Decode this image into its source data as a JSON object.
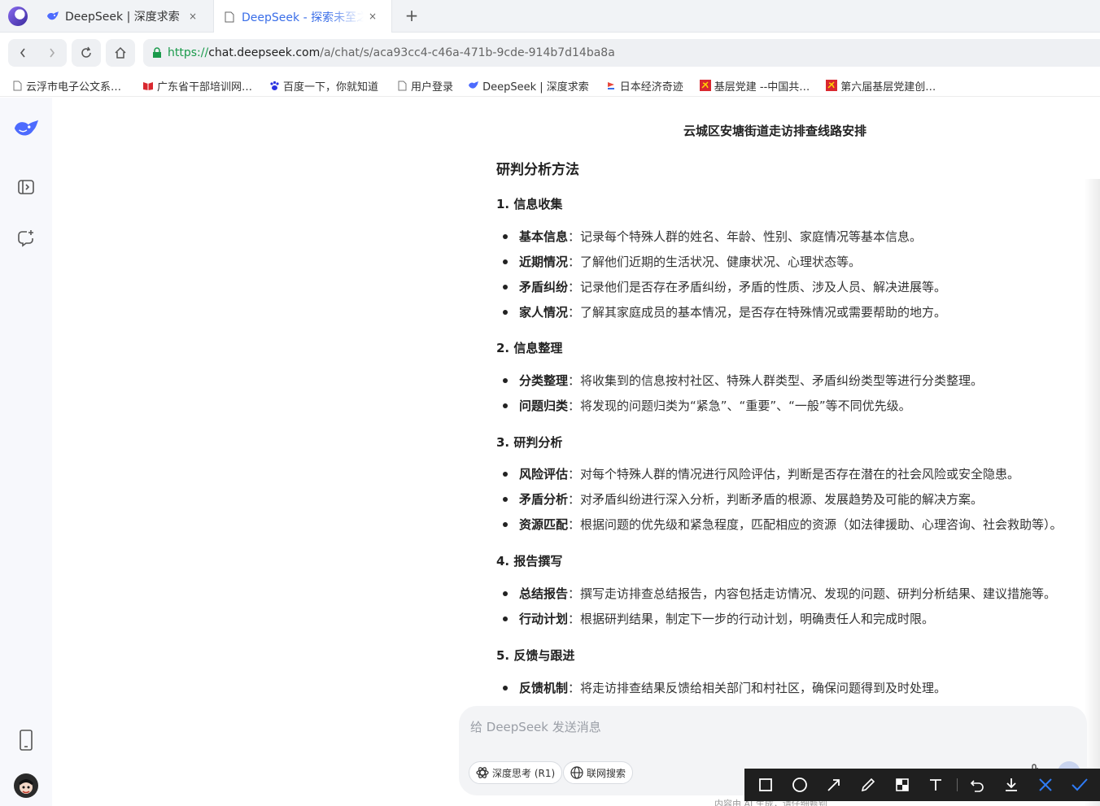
{
  "tabs": [
    {
      "title": "DeepSeek | 深度求索",
      "close": "×"
    },
    {
      "title": "DeepSeek - 探索未至之境",
      "close": "×"
    }
  ],
  "new_tab": "+",
  "address": {
    "scheme": "https://",
    "host": "chat.deepseek.com",
    "path": "/a/chat/s/aca93cc4-c46a-471b-9cde-914b7d14ba8a"
  },
  "bookmarks": [
    {
      "label": "云浮市电子公文系…",
      "icon": "page-icon"
    },
    {
      "label": "广东省干部培训网…",
      "icon": "book-icon"
    },
    {
      "label": "百度一下，你就知道",
      "icon": "baidu-paw-icon"
    },
    {
      "label": "用户登录",
      "icon": "page-icon"
    },
    {
      "label": "DeepSeek | 深度求索",
      "icon": "deepseek-whale-icon"
    },
    {
      "label": "日本经济奇迹",
      "icon": "bookmark-flag-icon"
    },
    {
      "label": "基层党建 --中国共…",
      "icon": "party-emblem-icon"
    },
    {
      "label": "第六届基层党建创…",
      "icon": "party-emblem-icon"
    }
  ],
  "document": {
    "title": "云城区安塘街道走访排查线路安排",
    "section_title": "研判分析方法",
    "sections": [
      {
        "heading": "1. 信息收集",
        "items": [
          {
            "label": "基本信息",
            "text": "：记录每个特殊人群的姓名、年龄、性别、家庭情况等基本信息。"
          },
          {
            "label": "近期情况",
            "text": "：了解他们近期的生活状况、健康状况、心理状态等。"
          },
          {
            "label": "矛盾纠纷",
            "text": "：记录他们是否存在矛盾纠纷，矛盾的性质、涉及人员、解决进展等。"
          },
          {
            "label": "家人情况",
            "text": "：了解其家庭成员的基本情况，是否存在特殊情况或需要帮助的地方。"
          }
        ]
      },
      {
        "heading": "2. 信息整理",
        "items": [
          {
            "label": "分类整理",
            "text": "：将收集到的信息按村社区、特殊人群类型、矛盾纠纷类型等进行分类整理。"
          },
          {
            "label": "问题归类",
            "text": "：将发现的问题归类为“紧急”、“重要”、“一般”等不同优先级。"
          }
        ]
      },
      {
        "heading": "3. 研判分析",
        "items": [
          {
            "label": "风险评估",
            "text": "：对每个特殊人群的情况进行风险评估，判断是否存在潜在的社会风险或安全隐患。"
          },
          {
            "label": "矛盾分析",
            "text": "：对矛盾纠纷进行深入分析，判断矛盾的根源、发展趋势及可能的解决方案。"
          },
          {
            "label": "资源匹配",
            "text": "：根据问题的优先级和紧急程度，匹配相应的资源（如法律援助、心理咨询、社会救助等）。"
          }
        ]
      },
      {
        "heading": "4. 报告撰写",
        "items": [
          {
            "label": "总结报告",
            "text": "：撰写走访排查总结报告，内容包括走访情况、发现的问题、研判分析结果、建议措施等。"
          },
          {
            "label": "行动计划",
            "text": "：根据研判结果，制定下一步的行动计划，明确责任人和完成时限。"
          }
        ]
      },
      {
        "heading": "5. 反馈与跟进",
        "items": [
          {
            "label": "反馈机制",
            "text": "：将走访排查结果反馈给相关部门和村社区，确保问题得到及时处理。"
          }
        ]
      }
    ]
  },
  "composer": {
    "placeholder": "给 DeepSeek 发送消息",
    "deep_think_label": "深度思考 (R1)",
    "web_search_label": "联网搜索"
  },
  "footer_note": "内容由 AI 生成，请仔细甄别",
  "colors": {
    "accent": "#4d6bfe",
    "link_blue": "#3a6ee8",
    "secure_green": "#1a9a4b",
    "toolbar_bg": "#1f1f1f",
    "cancel_blue": "#2f7cf6"
  }
}
